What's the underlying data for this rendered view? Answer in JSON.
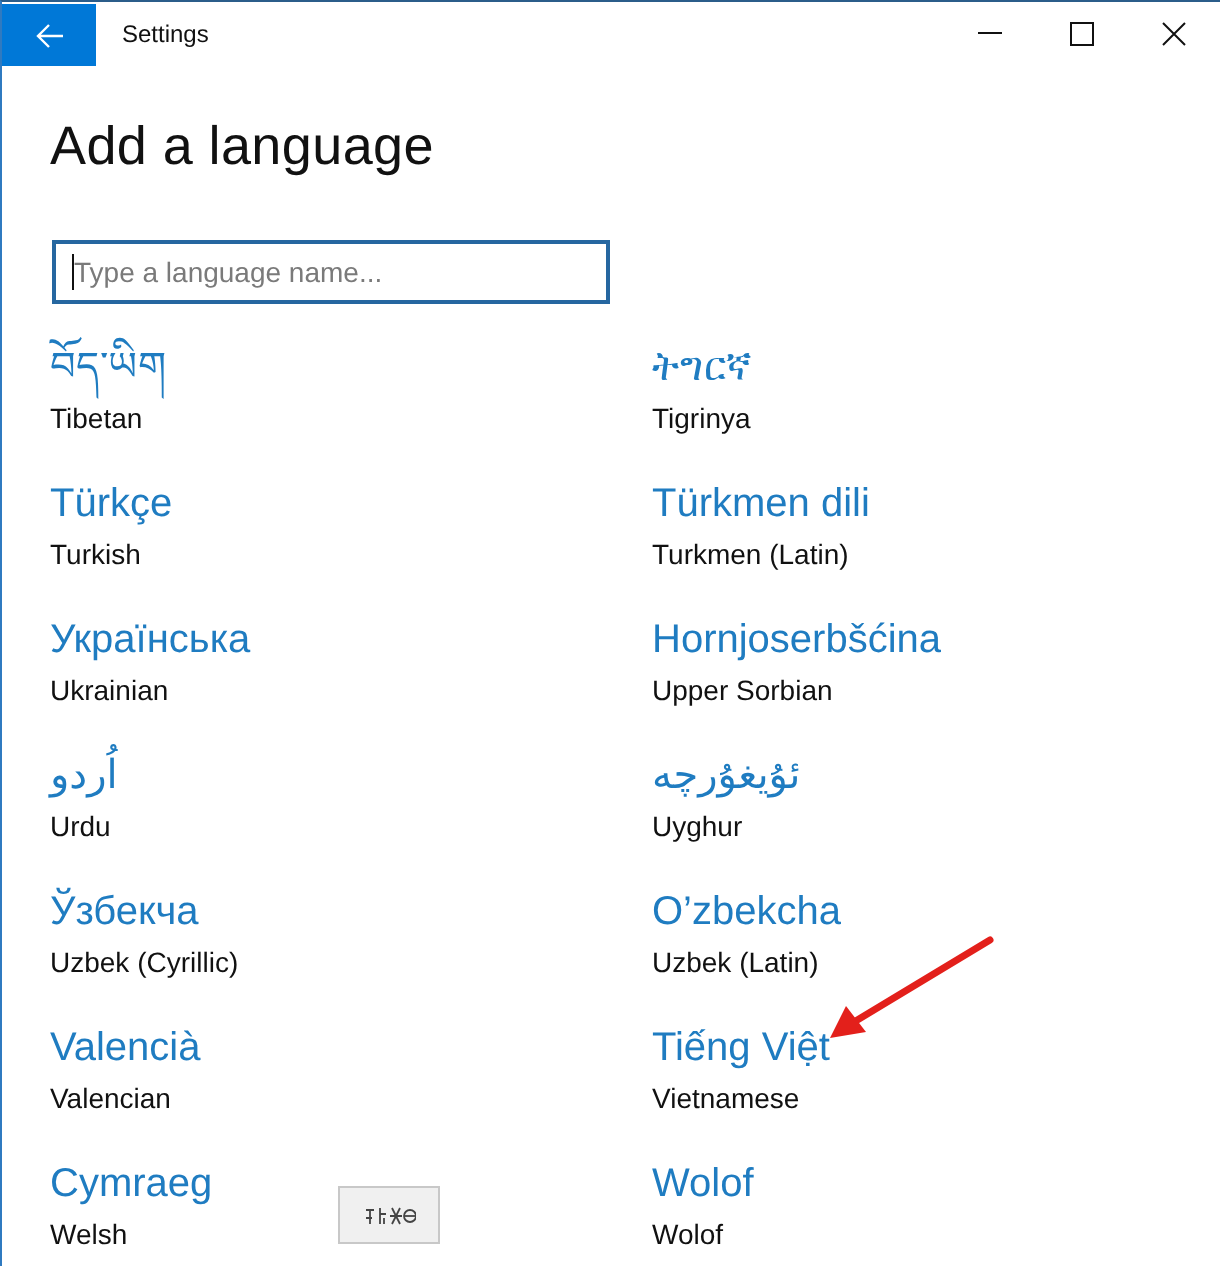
{
  "window": {
    "title": "Settings"
  },
  "page": {
    "heading": "Add a language",
    "search": {
      "placeholder": "Type a language name...",
      "focused": true
    }
  },
  "languages": [
    {
      "native": "བོད་ཡིག",
      "english": "Tibetan",
      "marked": false
    },
    {
      "native": "ትግርኛ",
      "english": "Tigrinya",
      "marked": false
    },
    {
      "native": "Türkçe",
      "english": "Turkish",
      "marked": false
    },
    {
      "native": "Türkmen dili",
      "english": "Turkmen (Latin)",
      "marked": false
    },
    {
      "native": "Українська",
      "english": "Ukrainian",
      "marked": false
    },
    {
      "native": "Hornjoserbšćina",
      "english": "Upper Sorbian",
      "marked": false
    },
    {
      "native": "اُردو",
      "english": "Urdu",
      "marked": false
    },
    {
      "native": "ئۇيغۇرچە",
      "english": "Uyghur",
      "marked": false
    },
    {
      "native": "Ўзбекча",
      "english": "Uzbek (Cyrillic)",
      "marked": false
    },
    {
      "native": "O’zbekcha",
      "english": "Uzbek (Latin)",
      "marked": false
    },
    {
      "native": "Valencià",
      "english": "Valencian",
      "marked": false
    },
    {
      "native": "Tiếng Việt",
      "english": "Vietnamese",
      "marked": true
    },
    {
      "native": "Cymraeg",
      "english": "Welsh",
      "marked": false
    },
    {
      "native": "Wolof",
      "english": "Wolof",
      "marked": false
    }
  ]
}
